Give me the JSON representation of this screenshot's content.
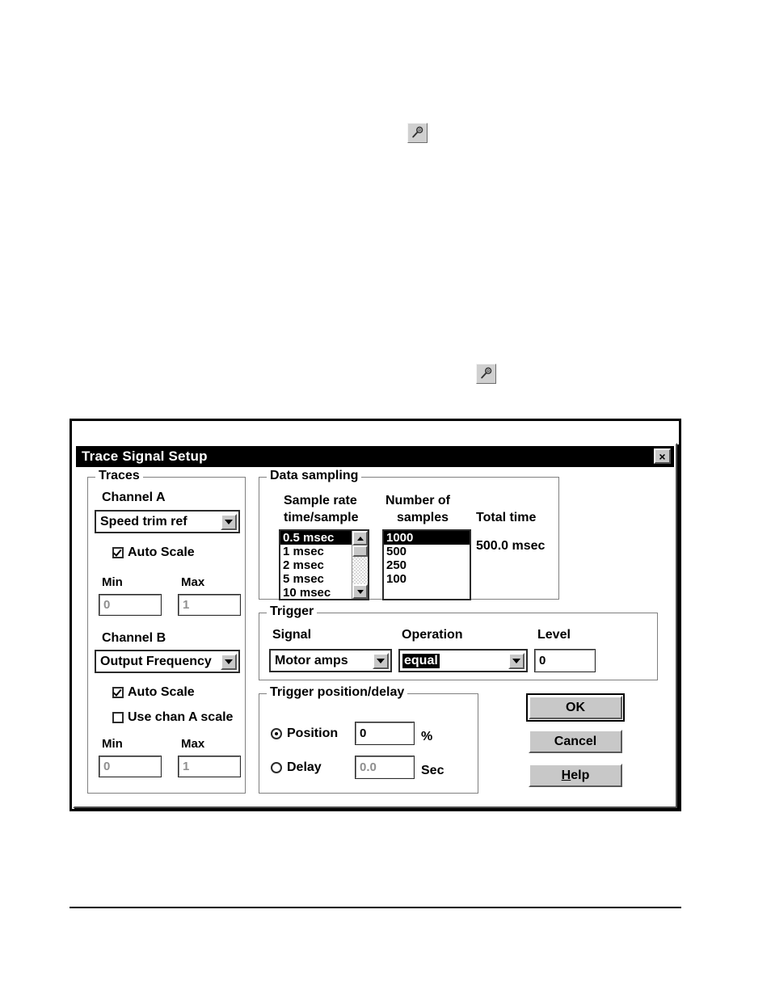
{
  "page": {
    "icons": [
      {
        "name": "wrench-tool-icon",
        "glyph": "wrench"
      },
      {
        "name": "wrench-tool-icon",
        "glyph": "wrench"
      }
    ]
  },
  "dialog": {
    "title": "Trace Signal Setup",
    "close_label": "×",
    "traces": {
      "legend": "Traces",
      "channel_a": {
        "label": "Channel A",
        "signal_value": "Speed trim ref",
        "auto_scale_label": "Auto Scale",
        "auto_scale_checked": true,
        "min_label": "Min",
        "max_label": "Max",
        "min_value": "0",
        "max_value": "1"
      },
      "channel_b": {
        "label": "Channel B",
        "signal_value": "Output Frequency",
        "auto_scale_label": "Auto Scale",
        "auto_scale_checked": true,
        "use_chan_a_label": "Use chan A scale",
        "use_chan_a_checked": false,
        "min_label": "Min",
        "max_label": "Max",
        "min_value": "0",
        "max_value": "1"
      }
    },
    "data_sampling": {
      "legend": "Data sampling",
      "sample_rate_label_line1": "Sample rate",
      "sample_rate_label_line2": "time/sample",
      "num_samples_label_line1": "Number of",
      "num_samples_label_line2": "samples",
      "total_time_label": "Total time",
      "total_time_value": "500.0 msec",
      "sample_rate_options": [
        "0.5 msec",
        "1 msec",
        "2 msec",
        "5 msec",
        "10 msec"
      ],
      "sample_rate_selected": "0.5 msec",
      "num_samples_options": [
        "1000",
        "500",
        "250",
        "100"
      ],
      "num_samples_selected": "1000"
    },
    "trigger": {
      "legend": "Trigger",
      "signal_label": "Signal",
      "signal_value": "Motor amps",
      "operation_label": "Operation",
      "operation_value": "equal",
      "level_label": "Level",
      "level_value": "0"
    },
    "trigger_position": {
      "legend": "Trigger position/delay",
      "position_label": "Position",
      "position_selected": true,
      "position_value": "0",
      "position_unit": "%",
      "delay_label": "Delay",
      "delay_selected": false,
      "delay_value": "0.0",
      "delay_unit": "Sec"
    },
    "buttons": {
      "ok": "OK",
      "cancel": "Cancel",
      "help_accel": "H",
      "help_rest": "elp"
    }
  }
}
